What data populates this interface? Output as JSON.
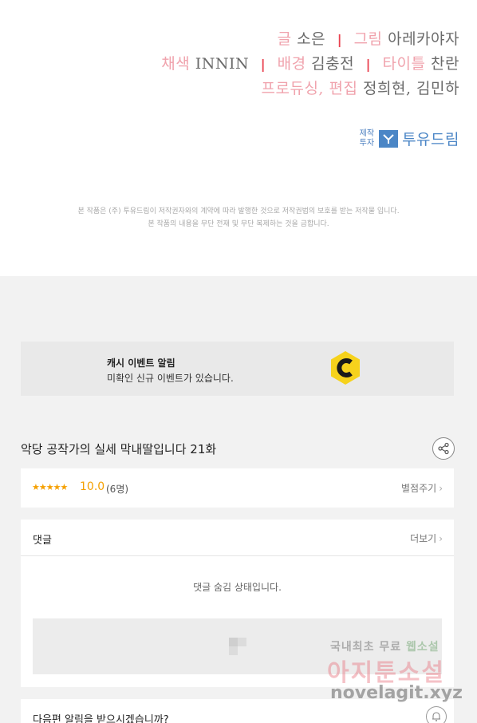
{
  "credits": {
    "line1": [
      {
        "role": "글",
        "name": "소은"
      },
      {
        "role": "그림",
        "name": "아레카야자"
      }
    ],
    "line2": [
      {
        "role": "채색",
        "name": "INNIN"
      },
      {
        "role": "배경",
        "name": "김충전"
      },
      {
        "role": "타이틀",
        "name": "찬란"
      }
    ],
    "line3": [
      {
        "role": "프로듀싱, 편집",
        "name": "정희현, 김민하"
      }
    ],
    "separator": "|",
    "producer_small_1": "제작",
    "producer_small_2": "투자",
    "producer_name": "투유드림",
    "producer_logo_icon": "tuyu-dream-logo-icon",
    "copyright_1": "본 작품은 (주) 투유드림이 저작권자와의 계약에 따라 발행한 것으로 저작권법의 보호를 받는 저작물 입니다.",
    "copyright_2": "본 작품의 내용을 무단 전재 및 무단 복제하는 것을 금합니다."
  },
  "event": {
    "title": "캐시 이벤트 알림",
    "description": "미확인 신규 이벤트가 있습니다.",
    "icon": "cash-coin-icon",
    "accent": "#f6d21c"
  },
  "episode": {
    "title": "악당 공작가의 실세 막내딸입니다 21화",
    "share_icon": "share-icon"
  },
  "rating": {
    "stars": "★★★★★",
    "score": "10.0",
    "count": "(6명)",
    "rate_button": "별점주기",
    "chevron": "›",
    "star_color": "#f5a000"
  },
  "comments": {
    "title": "댓글",
    "more_button": "더보기",
    "chevron": "›",
    "hidden_message": "댓글 숨김 상태입니다.",
    "placeholder_icon": "image-placeholder-icon"
  },
  "notify": {
    "text": "다음편 알림을 받으시겠습니까?",
    "bell_icon": "bell-icon"
  },
  "watermark": {
    "line1_a": "국내최초 무료 ",
    "line1_b": "웹소설",
    "line2": "아지툰소설",
    "line3": "novelagit.xyz"
  }
}
